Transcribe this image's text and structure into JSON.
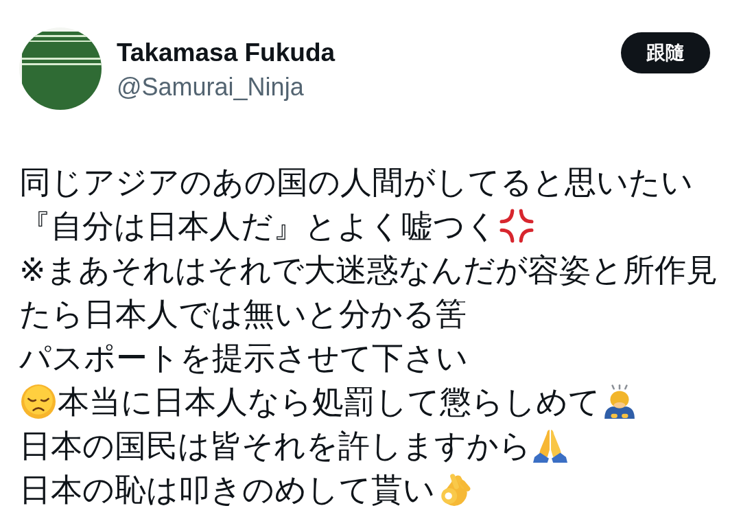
{
  "tweet": {
    "author": {
      "name": "Takamasa Fukuda",
      "handle": "@Samurai_Ninja"
    },
    "follow_button": {
      "label": "跟隨"
    },
    "lines": [
      {
        "segments": [
          {
            "kind": "text",
            "text": "同じアジアのあの国の人間がしてると思いたい"
          }
        ]
      },
      {
        "segments": [
          {
            "kind": "text",
            "text": "『自分は日本人だ』とよく嘘つく"
          },
          {
            "kind": "anger"
          }
        ]
      },
      {
        "segments": [
          {
            "kind": "text",
            "text": "※まあそれはそれで大迷惑なんだが容姿と所作見"
          }
        ]
      },
      {
        "segments": [
          {
            "kind": "text",
            "text": "たら日本人では無いと分かる筈"
          }
        ]
      },
      {
        "segments": [
          {
            "kind": "text",
            "text": "パスポートを提示させて下さい"
          }
        ]
      },
      {
        "segments": [
          {
            "kind": "sad"
          },
          {
            "kind": "text",
            "text": "本当に日本人なら処罰して懲らしめて"
          },
          {
            "kind": "bow"
          }
        ]
      },
      {
        "segments": [
          {
            "kind": "text",
            "text": "日本の国民は皆それを許しますから"
          },
          {
            "kind": "pray"
          }
        ]
      },
      {
        "segments": [
          {
            "kind": "text",
            "text": "日本の恥は叩きのめして貰い"
          },
          {
            "kind": "ok"
          }
        ]
      }
    ]
  }
}
